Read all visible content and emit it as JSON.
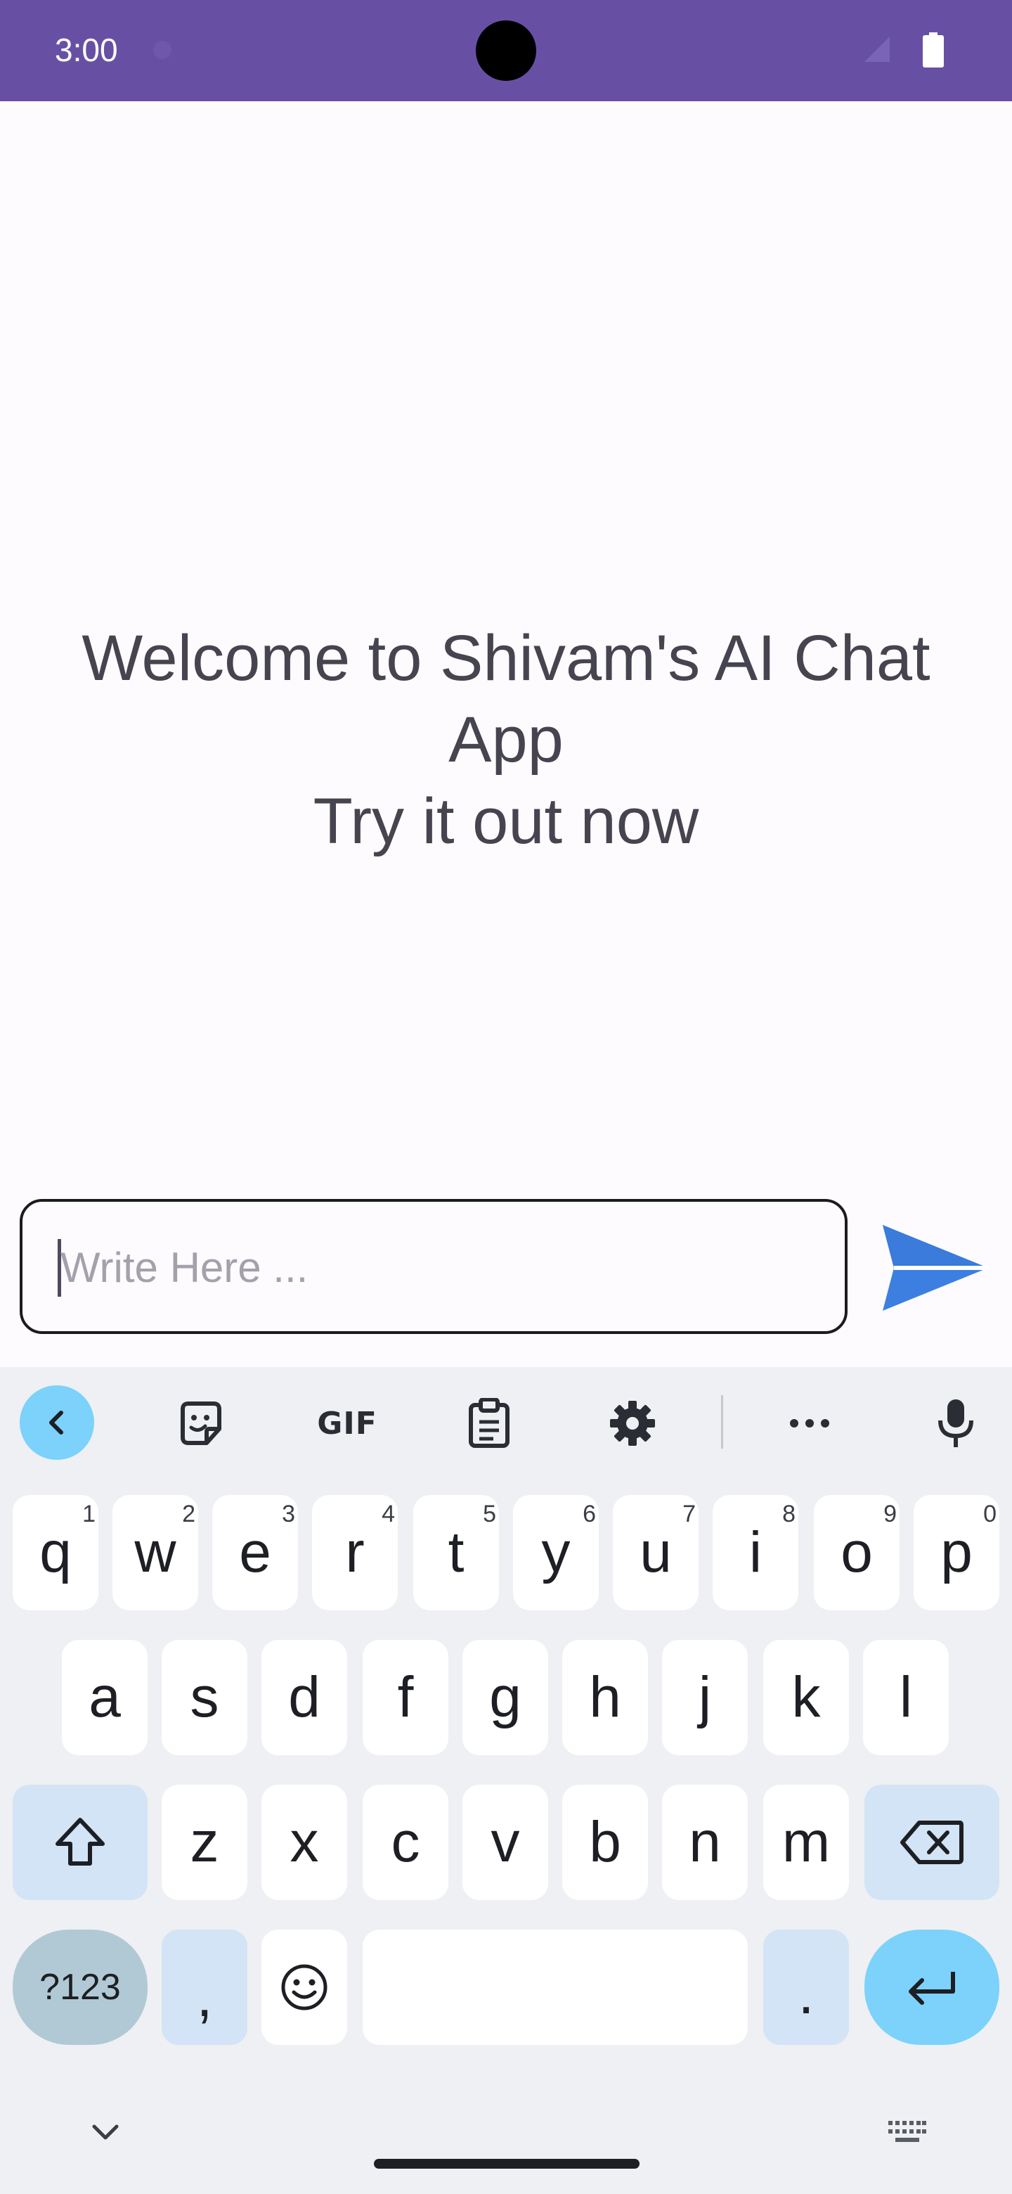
{
  "status_bar": {
    "time": "3:00",
    "background": "#6750a4"
  },
  "welcome": {
    "line1": "Welcome to Shivam's AI Chat",
    "line2": "App",
    "line3": "Try it out now"
  },
  "chat": {
    "placeholder": "Write Here ...",
    "value": "",
    "send_icon": "send-icon",
    "send_color": "#3c7fe0"
  },
  "keyboard": {
    "toolbar": {
      "back_icon": "chevron-left-icon",
      "sticker_icon": "sticker-icon",
      "gif_label": "GIF",
      "clipboard_icon": "clipboard-icon",
      "settings_icon": "gear-icon",
      "more_icon": "more-horizontal-icon",
      "mic_icon": "microphone-icon"
    },
    "row1": [
      {
        "key": "q",
        "hint": "1"
      },
      {
        "key": "w",
        "hint": "2"
      },
      {
        "key": "e",
        "hint": "3"
      },
      {
        "key": "r",
        "hint": "4"
      },
      {
        "key": "t",
        "hint": "5"
      },
      {
        "key": "y",
        "hint": "6"
      },
      {
        "key": "u",
        "hint": "7"
      },
      {
        "key": "i",
        "hint": "8"
      },
      {
        "key": "o",
        "hint": "9"
      },
      {
        "key": "p",
        "hint": "0"
      }
    ],
    "row2": [
      "a",
      "s",
      "d",
      "f",
      "g",
      "h",
      "j",
      "k",
      "l"
    ],
    "row3": [
      "z",
      "x",
      "c",
      "v",
      "b",
      "n",
      "m"
    ],
    "row4": {
      "symbols_label": "?123",
      "comma": ",",
      "emoji_icon": "emoji-icon",
      "space": "",
      "period": ".",
      "enter_icon": "enter-icon"
    },
    "accent_color": "#7cd2fb"
  }
}
